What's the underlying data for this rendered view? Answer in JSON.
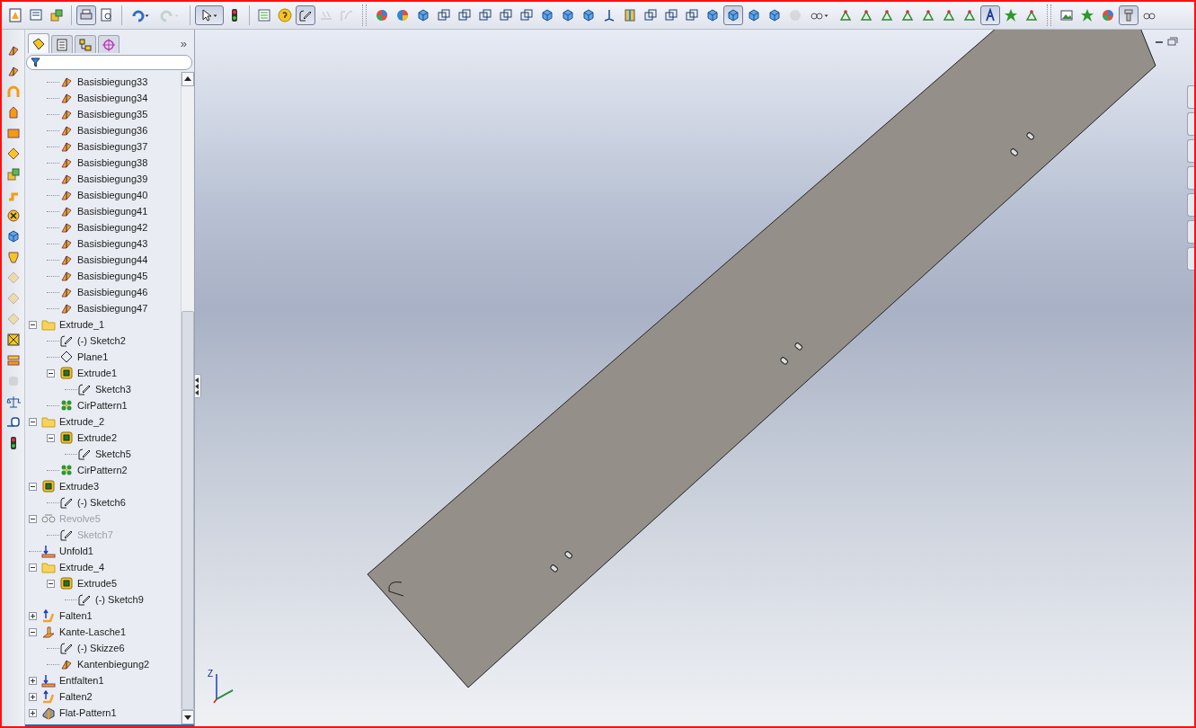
{
  "toolbar": {
    "groups": [
      {
        "buttons": [
          {
            "kind": "chart-doc",
            "pressed": false,
            "disabled": false
          },
          {
            "kind": "form",
            "pressed": false,
            "disabled": false
          },
          {
            "kind": "boxes",
            "pressed": false,
            "disabled": false
          }
        ]
      },
      {
        "buttons": [
          {
            "kind": "printer",
            "pressed": true,
            "disabled": false
          },
          {
            "kind": "magnifier",
            "pressed": false,
            "disabled": false
          }
        ]
      },
      {
        "buttons": [
          {
            "kind": "undo",
            "pressed": false,
            "disabled": false,
            "dropdown": true
          },
          {
            "kind": "redo",
            "pressed": false,
            "disabled": true,
            "dropdown": true
          }
        ]
      },
      {
        "buttons": [
          {
            "kind": "pointer",
            "pressed": true,
            "disabled": false,
            "dropdown": true
          },
          {
            "kind": "traffic-light",
            "pressed": false,
            "disabled": false
          }
        ]
      },
      {
        "buttons": [
          {
            "kind": "list",
            "pressed": false,
            "disabled": false
          },
          {
            "kind": "help",
            "pressed": false,
            "disabled": false
          },
          {
            "kind": "sketch",
            "pressed": true,
            "disabled": false
          },
          {
            "kind": "dimension",
            "pressed": false,
            "disabled": true
          },
          {
            "kind": "curve",
            "pressed": false,
            "disabled": true
          }
        ]
      },
      {
        "buttons": [
          {
            "kind": "color-ball",
            "pressed": false,
            "disabled": false
          },
          {
            "kind": "pie",
            "pressed": false,
            "disabled": false
          },
          {
            "kind": "cube",
            "pressed": false,
            "disabled": false
          },
          {
            "kind": "wire-cube",
            "pressed": false,
            "disabled": false
          },
          {
            "kind": "wire-cube",
            "pressed": false,
            "disabled": false
          },
          {
            "kind": "wire-cube",
            "pressed": false,
            "disabled": false
          },
          {
            "kind": "wire-cube",
            "pressed": false,
            "disabled": false
          },
          {
            "kind": "wire-cube",
            "pressed": false,
            "disabled": false
          },
          {
            "kind": "cube",
            "pressed": false,
            "disabled": false
          },
          {
            "kind": "cube",
            "pressed": false,
            "disabled": false
          },
          {
            "kind": "cube",
            "pressed": false,
            "disabled": false
          },
          {
            "kind": "axis",
            "pressed": false,
            "disabled": false
          },
          {
            "kind": "section",
            "pressed": false,
            "disabled": false
          },
          {
            "kind": "wire-cube",
            "pressed": false,
            "disabled": false
          },
          {
            "kind": "wire-cube",
            "pressed": false,
            "disabled": false
          },
          {
            "kind": "wire-cube",
            "pressed": false,
            "disabled": false
          },
          {
            "kind": "cube",
            "pressed": false,
            "disabled": false
          },
          {
            "kind": "cube",
            "pressed": true,
            "disabled": false
          },
          {
            "kind": "cube",
            "pressed": false,
            "disabled": false
          },
          {
            "kind": "cube",
            "pressed": false,
            "disabled": false
          },
          {
            "kind": "sphere",
            "pressed": false,
            "disabled": true
          },
          {
            "kind": "glasses",
            "pressed": false,
            "disabled": false,
            "dropdown": true
          },
          {
            "kind": "relation",
            "pressed": false,
            "disabled": false
          },
          {
            "kind": "relation",
            "pressed": false,
            "disabled": false
          },
          {
            "kind": "relation",
            "pressed": false,
            "disabled": false
          },
          {
            "kind": "relation",
            "pressed": false,
            "disabled": false
          },
          {
            "kind": "relation",
            "pressed": false,
            "disabled": false
          },
          {
            "kind": "relation",
            "pressed": false,
            "disabled": false
          },
          {
            "kind": "relation",
            "pressed": false,
            "disabled": false
          },
          {
            "kind": "letter-tool",
            "pressed": true,
            "disabled": false
          },
          {
            "kind": "star",
            "pressed": false,
            "disabled": false
          },
          {
            "kind": "relation",
            "pressed": false,
            "disabled": false
          }
        ]
      },
      {
        "buttons": [
          {
            "kind": "picture",
            "pressed": false,
            "disabled": false
          },
          {
            "kind": "star",
            "pressed": false,
            "disabled": false
          },
          {
            "kind": "color-ball",
            "pressed": false,
            "disabled": false
          },
          {
            "kind": "screw",
            "pressed": true,
            "disabled": false
          },
          {
            "kind": "glasses",
            "pressed": false,
            "disabled": false
          }
        ]
      }
    ]
  },
  "command_strip": [
    {
      "kind": "flange",
      "disabled": false
    },
    {
      "kind": "bend",
      "disabled": false
    },
    {
      "kind": "hem",
      "disabled": false
    },
    {
      "kind": "corner",
      "disabled": false
    },
    {
      "kind": "sheet",
      "disabled": false
    },
    {
      "kind": "diamond",
      "disabled": false
    },
    {
      "kind": "boxes",
      "disabled": false
    },
    {
      "kind": "jog",
      "disabled": false
    },
    {
      "kind": "ring-x",
      "disabled": false
    },
    {
      "kind": "cube",
      "disabled": false
    },
    {
      "kind": "cup",
      "disabled": false
    },
    {
      "kind": "diamond",
      "disabled": true
    },
    {
      "kind": "diamond",
      "disabled": true
    },
    {
      "kind": "diamond",
      "disabled": true
    },
    {
      "kind": "box-x",
      "disabled": false
    },
    {
      "kind": "stack",
      "disabled": false
    },
    {
      "kind": "cylinder",
      "disabled": true
    },
    {
      "kind": "scales",
      "disabled": false
    },
    {
      "kind": "tape",
      "disabled": false
    },
    {
      "kind": "traffic-light",
      "disabled": false
    }
  ],
  "panel": {
    "tabs": [
      {
        "kind": "feature-tree",
        "selected": true
      },
      {
        "kind": "properties",
        "selected": false
      },
      {
        "kind": "configurations",
        "selected": false
      },
      {
        "kind": "target",
        "selected": false
      }
    ],
    "more": "»"
  },
  "tree": [
    {
      "children": [
        {
          "label": "Basisbiegung33",
          "kind": "bend",
          "suppressed": false
        },
        {
          "label": "Basisbiegung34",
          "kind": "bend",
          "suppressed": false
        },
        {
          "label": "Basisbiegung35",
          "kind": "bend",
          "suppressed": false
        },
        {
          "label": "Basisbiegung36",
          "kind": "bend",
          "suppressed": false
        },
        {
          "label": "Basisbiegung37",
          "kind": "bend",
          "suppressed": false
        },
        {
          "label": "Basisbiegung38",
          "kind": "bend",
          "suppressed": false
        },
        {
          "label": "Basisbiegung39",
          "kind": "bend",
          "suppressed": false
        },
        {
          "label": "Basisbiegung40",
          "kind": "bend",
          "suppressed": false
        },
        {
          "label": "Basisbiegung41",
          "kind": "bend",
          "suppressed": false
        },
        {
          "label": "Basisbiegung42",
          "kind": "bend",
          "suppressed": false
        },
        {
          "label": "Basisbiegung43",
          "kind": "bend",
          "suppressed": false
        },
        {
          "label": "Basisbiegung44",
          "kind": "bend",
          "suppressed": false
        },
        {
          "label": "Basisbiegung45",
          "kind": "bend",
          "suppressed": false
        },
        {
          "label": "Basisbiegung46",
          "kind": "bend",
          "suppressed": false
        },
        {
          "label": "Basisbiegung47",
          "kind": "bend",
          "suppressed": false
        }
      ]
    },
    {
      "label": "Extrude_1",
      "kind": "folder",
      "expanded": true,
      "suppressed": false,
      "children": [
        {
          "label": "(-) Sketch2",
          "kind": "sketch",
          "suppressed": false
        },
        {
          "label": "Plane1",
          "kind": "plane",
          "suppressed": false
        },
        {
          "label": "Extrude1",
          "kind": "feature",
          "expanded": true,
          "suppressed": false,
          "children": [
            {
              "label": "Sketch3",
              "kind": "sketch",
              "suppressed": false
            }
          ]
        },
        {
          "label": "CirPattern1",
          "kind": "pattern",
          "suppressed": false
        }
      ]
    },
    {
      "label": "Extrude_2",
      "kind": "folder",
      "expanded": true,
      "suppressed": false,
      "children": [
        {
          "label": "Extrude2",
          "kind": "feature",
          "expanded": true,
          "suppressed": false,
          "children": [
            {
              "label": "Sketch5",
              "kind": "sketch",
              "suppressed": false
            }
          ]
        },
        {
          "label": "CirPattern2",
          "kind": "pattern",
          "suppressed": false
        }
      ]
    },
    {
      "label": "Extrude3",
      "kind": "feature",
      "expanded": true,
      "suppressed": false,
      "children": [
        {
          "label": "(-) Sketch6",
          "kind": "sketch",
          "suppressed": false
        }
      ]
    },
    {
      "label": "Revolve5",
      "kind": "revolve",
      "expanded": true,
      "suppressed": true,
      "children": [
        {
          "label": "Sketch7",
          "kind": "sketch",
          "suppressed": true
        }
      ]
    },
    {
      "label": "Unfold1",
      "kind": "unfold",
      "suppressed": false
    },
    {
      "label": "Extrude_4",
      "kind": "folder",
      "expanded": true,
      "suppressed": false,
      "children": [
        {
          "label": "Extrude5",
          "kind": "feature",
          "expanded": true,
          "suppressed": false,
          "children": [
            {
              "label": "(-) Sketch9",
              "kind": "sketch",
              "suppressed": false
            }
          ]
        }
      ]
    },
    {
      "label": "Falten1",
      "kind": "fold",
      "expanded": false,
      "suppressed": false
    },
    {
      "label": "Kante-Lasche1",
      "kind": "edge-flange",
      "expanded": true,
      "suppressed": false,
      "children": [
        {
          "label": "(-) Skizze6",
          "kind": "sketch",
          "suppressed": false
        },
        {
          "label": "Kantenbiegung2",
          "kind": "bend",
          "suppressed": false
        }
      ]
    },
    {
      "label": "Entfalten1",
      "kind": "unfold",
      "expanded": false,
      "suppressed": false
    },
    {
      "label": "Falten2",
      "kind": "fold",
      "expanded": false,
      "suppressed": false
    },
    {
      "label": "Flat-Pattern1",
      "kind": "flat",
      "expanded": false,
      "suppressed": false
    }
  ],
  "viewport": {
    "triad_label": "Z"
  }
}
